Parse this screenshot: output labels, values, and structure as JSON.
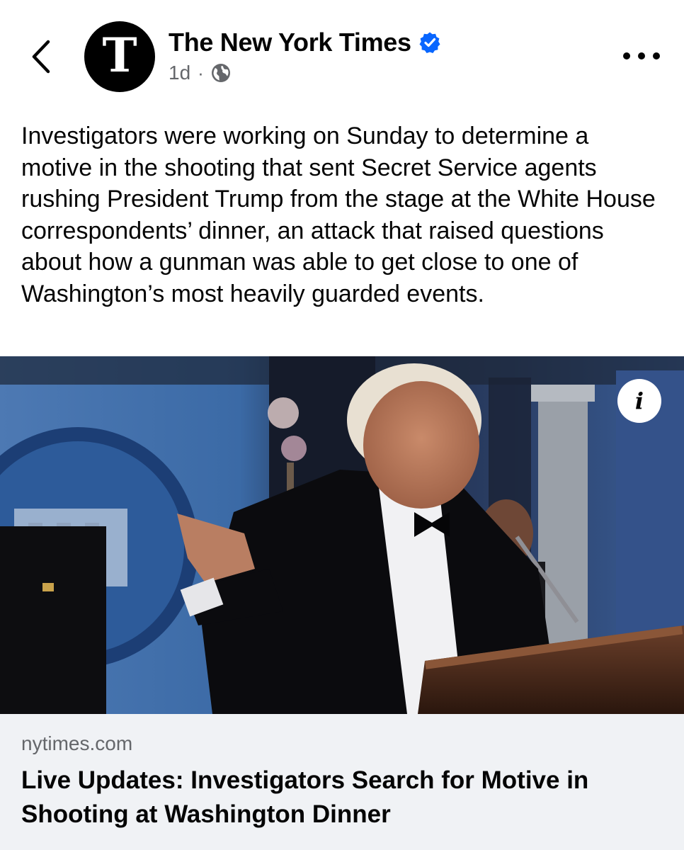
{
  "header": {
    "page_name": "The New York Times",
    "avatar_glyph": "T",
    "timestamp": "1d",
    "separator": "·",
    "verified_icon": "verified-badge-icon",
    "privacy_icon": "globe-icon",
    "back_icon": "chevron-left-icon",
    "more_icon": "more-horizontal-icon"
  },
  "post": {
    "text": "Investigators were working on Sunday to determine a motive in the shooting that sent Secret Service agents rushing President Trump from the stage at the White House correspondents’ dinner, an attack that raised questions about how a gunman was able to get close to one of Washington’s most heavily guarded events."
  },
  "link": {
    "info_icon": "info-icon",
    "info_glyph": "i",
    "domain": "nytimes.com",
    "headline": "Live Updates: Investigators Search for Motive in Shooting at Washington Dinner"
  },
  "colors": {
    "verified_blue": "#0866ff",
    "secondary_text": "#65676b",
    "card_footer_bg": "#f0f2f5",
    "primary_text": "#050505"
  }
}
